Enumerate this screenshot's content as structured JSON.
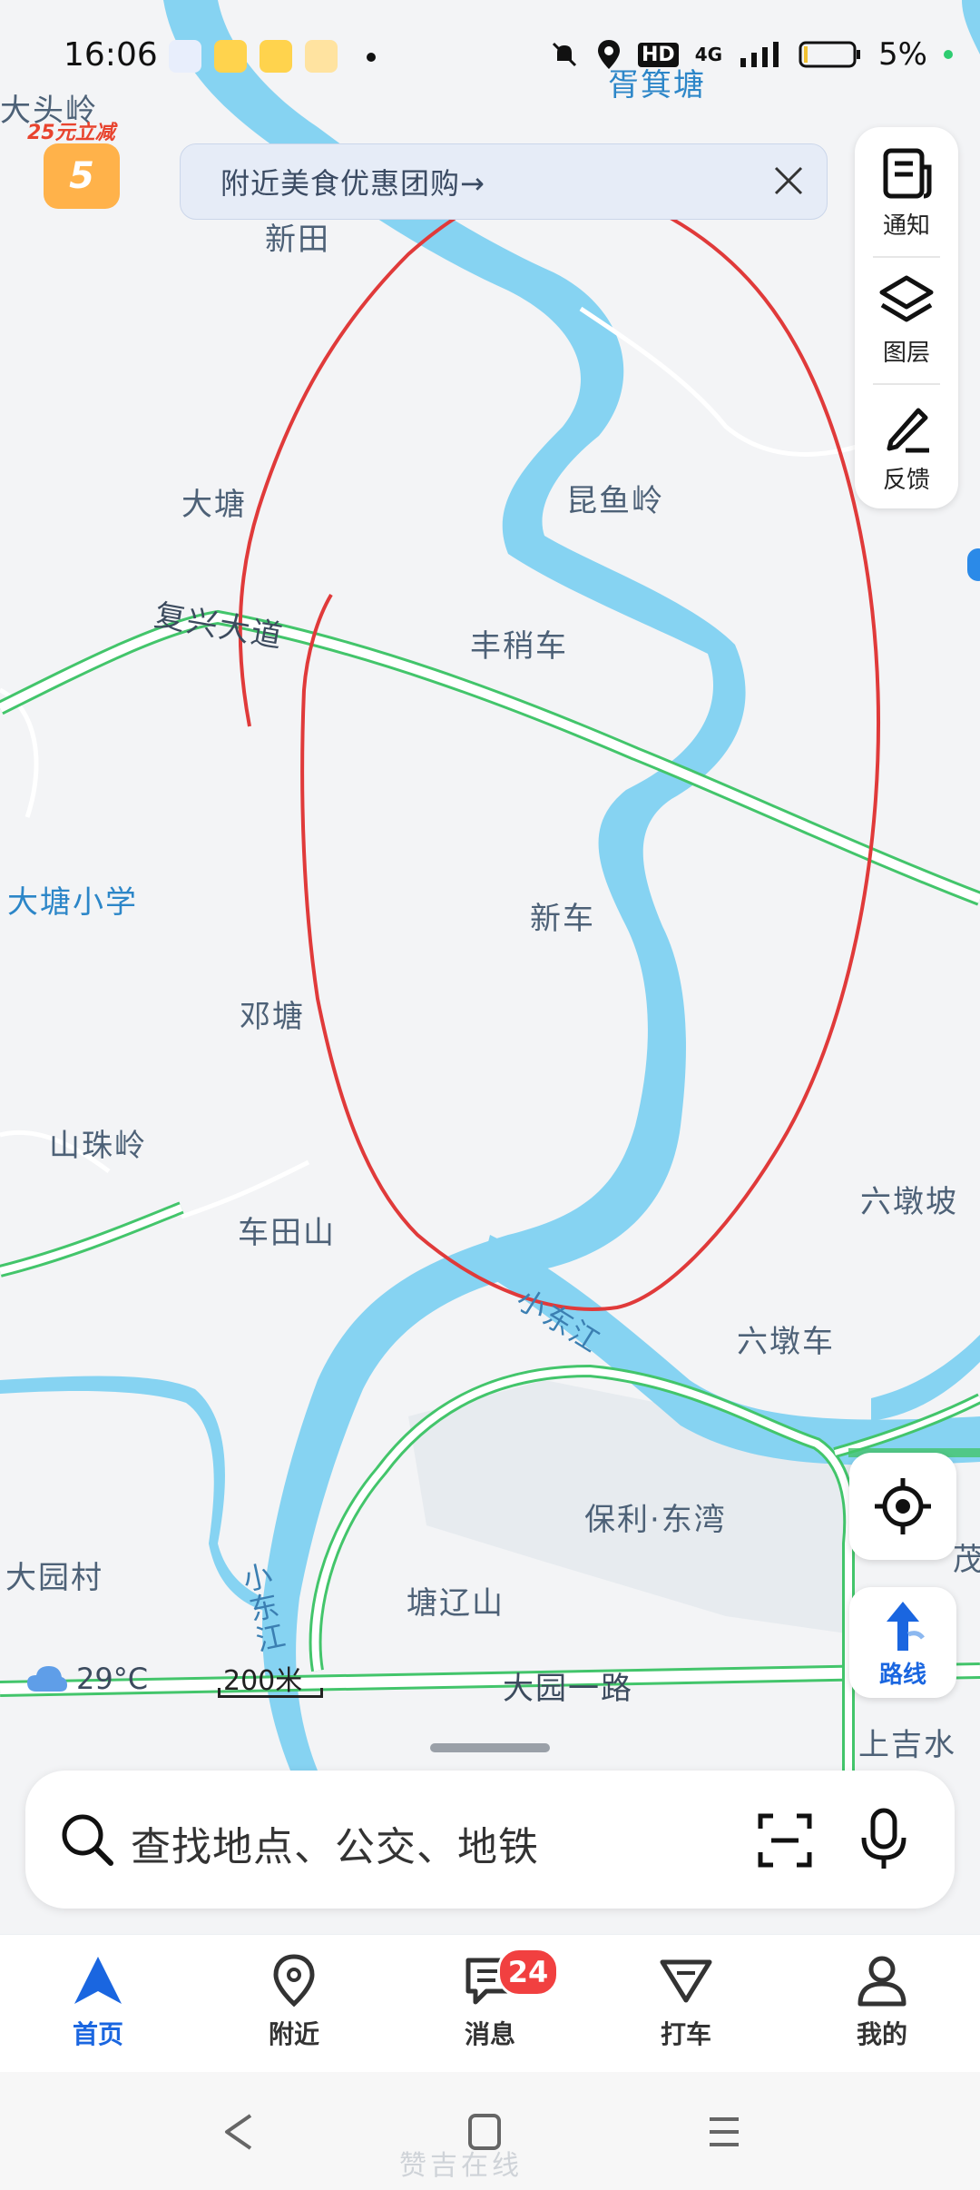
{
  "status_bar": {
    "time": "16:06",
    "network": "HD",
    "signal": "4G",
    "battery": "5%",
    "app_icons": [
      "baidu-icon",
      "meituan-icon",
      "app-icon",
      "weibo-icon"
    ]
  },
  "banner": {
    "text": "附近美食优惠团购→"
  },
  "promo": {
    "text": "25元立减",
    "amount": "5"
  },
  "side_panel": {
    "notice": "通知",
    "layers": "图层",
    "feedback": "反馈"
  },
  "map": {
    "places": {
      "top_right": "胥箕塘",
      "top_left": "大头岭",
      "xintian": "新田",
      "datang": "大塘",
      "kunyuling": "昆鱼岭",
      "road_fuxing": "复兴大道",
      "fengshaoche": "丰稍车",
      "datang_school": "大塘小学",
      "xinche": "新车",
      "dengtang": "邓塘",
      "shanzhuling": "山珠岭",
      "chetianshan": "车田山",
      "liudunpo": "六墩坡",
      "river_xiaodong_1": "小东江",
      "liudunche": "六墩车",
      "baoli": "保利·东湾",
      "dayuancun": "大园村",
      "river_xiaodong_2": "小东江",
      "tangliaoshan": "塘辽山",
      "road_dayuan": "大园一路",
      "shangjishui": "上吉水",
      "edge_mao": "茂"
    },
    "colors": {
      "river": "#86d3f2",
      "road": "#43c56b",
      "annotation": "#e03a3a"
    }
  },
  "weather": {
    "temp": "29°C"
  },
  "scale": {
    "label": "200米"
  },
  "controls": {
    "route": "路线"
  },
  "search": {
    "placeholder": "查找地点、公交、地铁"
  },
  "tabs": [
    {
      "label": "首页",
      "active": true
    },
    {
      "label": "附近"
    },
    {
      "label": "消息",
      "badge": "24"
    },
    {
      "label": "打车"
    },
    {
      "label": "我的"
    }
  ],
  "watermark": "赞吉在线"
}
